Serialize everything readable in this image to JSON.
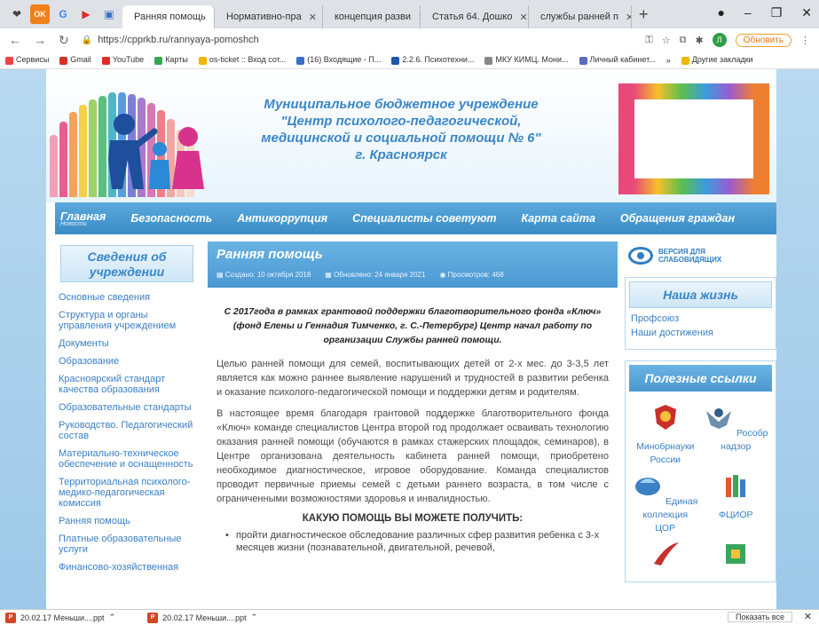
{
  "browser": {
    "tabs": [
      {
        "label": "Ранняя помощь",
        "active": true,
        "color": "#f5a623"
      },
      {
        "label": "Нормативно-пра",
        "active": false,
        "color": "#3a7bd5"
      },
      {
        "label": "концепция разви",
        "active": false,
        "color": "#4285f4"
      },
      {
        "label": "Статья 64. Дошко",
        "active": false,
        "color": "#c0392b"
      },
      {
        "label": "службы ранней п",
        "active": false,
        "color": "#4285f4"
      }
    ],
    "pinned": [
      "OK",
      "G"
    ],
    "url": "https://cpprkb.ru/rannyaya-pomoshch",
    "avatar_letter": "Л",
    "update_label": "Обновить",
    "bookmarks": [
      "Сервисы",
      "Gmail",
      "YouTube",
      "Карты",
      "os-ticket :: Вход сот...",
      "(16) Входящие - П...",
      "2.2.6. Психотехни...",
      "МКУ КИМЦ. Мони...",
      "Личный кабинет..."
    ],
    "bookmarks_more": "»",
    "other_bookmarks": "Другие закладки"
  },
  "header": {
    "title_lines": [
      "Муниципальное бюджетное учреждение",
      "\"Центр психолого-педагогической,",
      "медицинской и социальной помощи № 6\"",
      "г. Красноярск"
    ]
  },
  "menu": {
    "home": "Главная",
    "home_sub": "Новости",
    "items": [
      "Безопасность",
      "Антикоррупция",
      "Специалисты советуют",
      "Карта сайта",
      "Обращения граждан"
    ]
  },
  "left": {
    "heading": "Сведения об учреждении",
    "items": [
      "Основные сведения",
      "Структура и органы управления учреждением",
      "Документы",
      "Образование",
      "Красноярский стандарт качества образования",
      "Образовательные стандарты",
      "Руководство. Педагогический состав",
      "Материально-техническое обеспечение и оснащенность",
      "Территориальная психолого-медико-педагогическая комиссия",
      "Ранняя помощь",
      "Платные образовательные услуги",
      "Финансово-хозяйственная"
    ]
  },
  "article": {
    "title": "Ранняя помощь",
    "created": "Создано: 10 октября 2018",
    "updated": "Обновлено: 24 января 2021",
    "views": "Просмотров: 468",
    "lead": "С 2017года в рамках грантовой поддержки благотворительного фонда «Ключ» (фонд Елены и Геннадия Тимченко, г. С.-Петербург) Центр начал работу по организации Службы ранней помощи.",
    "p1": "Целью ранней помощи для семей, воспитывающих детей от 2-х мес. до 3-3,5 лет является как можно раннее выявление нарушений и трудностей в развитии ребенка и оказание психолого-педагогической помощи и поддержки детям и родителям.",
    "p2": "В настоящее время благодаря грантовой поддержке благотворительного фонда «Ключ» команде специалистов Центра второй год продолжает осваивать технологию оказания ранней помощи (обучаются в рамках стажерских площадок, семинаров), в Центре организована деятельность кабинета ранней помощи, приобретено необходимое диагностическое, игровое оборудование. Команда специалистов проводит первичные приемы семей с детьми раннего возраста, в том числе с ограниченными возможностями здоровья и инвалидностью.",
    "subhead": "КАКУЮ ПОМОЩЬ ВЫ МОЖЕТЕ ПОЛУЧИТЬ:",
    "bullet1": "пройти диагностическое обследование различных сфер развития ребенка с 3-х месяцев жизни (познавательной, двигательной, речевой,"
  },
  "right": {
    "vision_btn": "ВЕРСИЯ ДЛЯ СЛАБОВИДЯЩИХ",
    "life_heading": "Наша жизнь",
    "life_items": [
      "Профсоюз",
      "Наши достижения"
    ],
    "links_heading": "Полезные ссылки",
    "links": [
      "Минобрнауки России",
      "Рособр надзор",
      "Единая коллекция ЦОР",
      "ФЦИОР"
    ]
  },
  "downloads": {
    "items": [
      "20.02.17 Меньши....ppt",
      "20.02.17 Меньши....ppt"
    ],
    "show_all": "Показать все"
  },
  "colors": {
    "accent": "#3a86c8",
    "menu_bg": "#4b98d2",
    "link": "#3b7fc4"
  }
}
